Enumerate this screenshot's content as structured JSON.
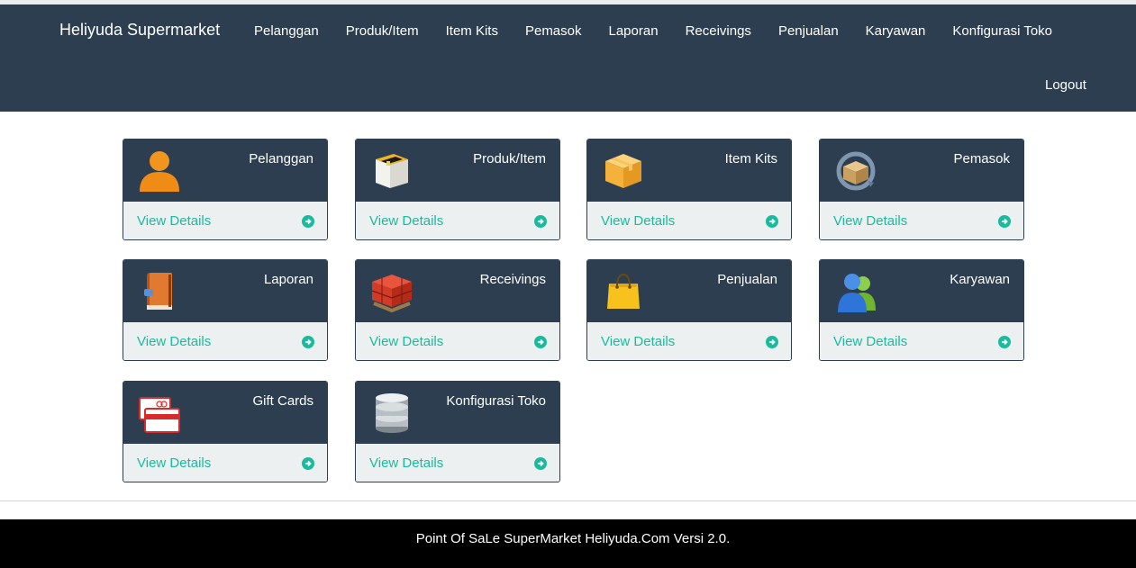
{
  "brand": "Heliyuda Supermarket",
  "nav": {
    "items": [
      "Pelanggan",
      "Produk/Item",
      "Item Kits",
      "Pemasok",
      "Laporan",
      "Receivings",
      "Penjualan",
      "Karyawan",
      "Konfigurasi Toko"
    ],
    "logout": "Logout"
  },
  "tiles": [
    {
      "title": "Pelanggan",
      "icon": "customer-icon",
      "link": "View Details"
    },
    {
      "title": "Produk/Item",
      "icon": "product-box-icon",
      "link": "View Details"
    },
    {
      "title": "Item Kits",
      "icon": "item-kits-box-icon",
      "link": "View Details"
    },
    {
      "title": "Pemasok",
      "icon": "supplier-icon",
      "link": "View Details"
    },
    {
      "title": "Laporan",
      "icon": "report-book-icon",
      "link": "View Details"
    },
    {
      "title": "Receivings",
      "icon": "receivings-pallet-icon",
      "link": "View Details"
    },
    {
      "title": "Penjualan",
      "icon": "sales-bag-icon",
      "link": "View Details"
    },
    {
      "title": "Karyawan",
      "icon": "employees-icon",
      "link": "View Details"
    },
    {
      "title": "Gift Cards",
      "icon": "gift-cards-icon",
      "link": "View Details"
    },
    {
      "title": "Konfigurasi Toko",
      "icon": "database-config-icon",
      "link": "View Details"
    }
  ],
  "footer": {
    "text": "Point Of SaLe SuperMarket Heliyuda.Com Versi 2.0."
  },
  "colors": {
    "navbar": "#2c3e50",
    "accent": "#18bc9c",
    "tile_footer": "#ecf0f1",
    "footer": "#000000"
  }
}
